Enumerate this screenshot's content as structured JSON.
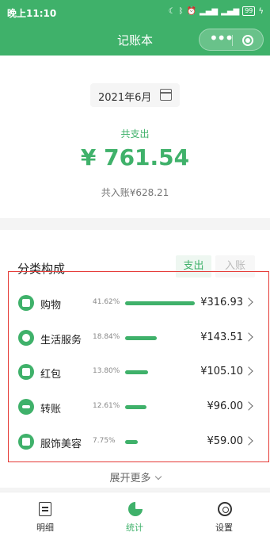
{
  "status_bar": {
    "time": "晚上11:10",
    "icons": [
      "moon-icon",
      "bluetooth-icon",
      "alarm-icon",
      "hd-icon",
      "signal-icon",
      "wifi-signal-icon",
      "battery-icon",
      "charging-icon"
    ],
    "battery_level": "99"
  },
  "header": {
    "title": "记账本",
    "background_color": "#3fb16a"
  },
  "summary": {
    "month": "2021年6月",
    "total_label": "共支出",
    "total_amount": "¥ 761.54",
    "income_text": "共入账¥628.21"
  },
  "category": {
    "title": "分类构成",
    "tabs": [
      {
        "label": "支出",
        "active": true
      },
      {
        "label": "入账",
        "active": false
      }
    ],
    "items": [
      {
        "name": "购物",
        "percent": "41.62%",
        "share": 0.4162,
        "amount": "¥316.93",
        "icon": "shopping-bag-icon"
      },
      {
        "name": "生活服务",
        "percent": "18.84%",
        "share": 0.1884,
        "amount": "¥143.51",
        "icon": "water-drop-icon"
      },
      {
        "name": "红包",
        "percent": "13.80%",
        "share": 0.138,
        "amount": "¥105.10",
        "icon": "red-packet-icon"
      },
      {
        "name": "转账",
        "percent": "12.61%",
        "share": 0.1261,
        "amount": "¥96.00",
        "icon": "transfer-arrows-icon"
      },
      {
        "name": "服饰美容",
        "percent": "7.75%",
        "share": 0.0775,
        "amount": "¥59.00",
        "icon": "shirt-icon"
      }
    ],
    "expand_label": "展开更多"
  },
  "bottom_nav": [
    {
      "label": "明细",
      "icon": "list-icon",
      "active": false
    },
    {
      "label": "统计",
      "icon": "pie-chart-icon",
      "active": true
    },
    {
      "label": "设置",
      "icon": "gear-icon",
      "active": false
    }
  ],
  "accent_color": "#3fb16a",
  "highlight_color": "#e53935"
}
